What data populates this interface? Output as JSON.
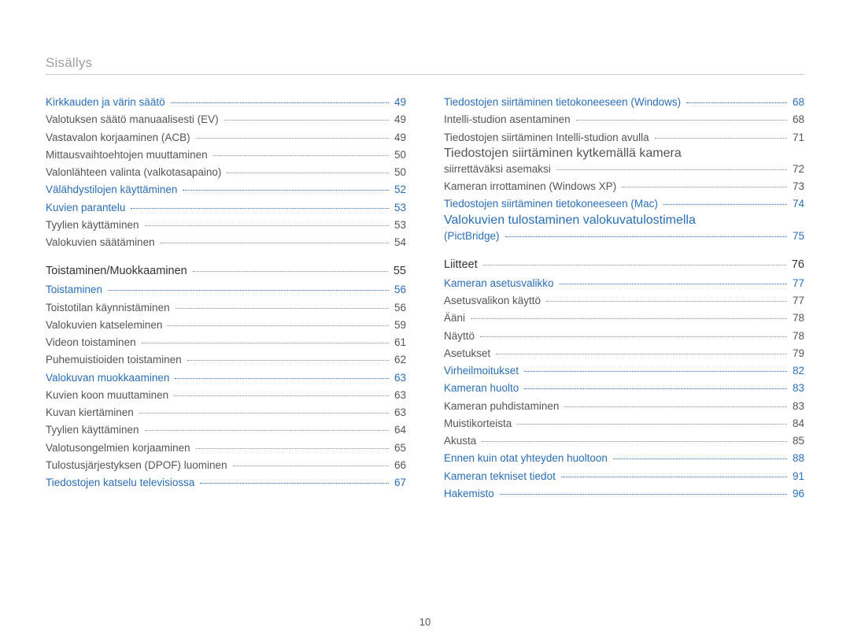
{
  "title": "Sisällys",
  "page_number": "10",
  "left": [
    {
      "label": "Kirkkauden ja värin säätö",
      "page": "49",
      "style": "blue"
    },
    {
      "label": "Valotuksen säätö manuaalisesti (EV)",
      "page": "49",
      "style": ""
    },
    {
      "label": "Vastavalon korjaaminen (ACB)",
      "page": "49",
      "style": ""
    },
    {
      "label": "Mittausvaihtoehtojen muuttaminen",
      "page": "50",
      "style": ""
    },
    {
      "label": "Valonlähteen valinta (valkotasapaino)",
      "page": "50",
      "style": ""
    },
    {
      "label": "Välähdystilojen käyttäminen",
      "page": "52",
      "style": "blue"
    },
    {
      "label": "Kuvien parantelu",
      "page": "53",
      "style": "blue"
    },
    {
      "label": "Tyylien käyttäminen",
      "page": "53",
      "style": ""
    },
    {
      "label": "Valokuvien säätäminen",
      "page": "54",
      "style": ""
    },
    {
      "label": "Toistaminen/Muokkaaminen",
      "page": "55",
      "style": "section-head dark"
    },
    {
      "label": "Toistaminen",
      "page": "56",
      "style": "blue"
    },
    {
      "label": "Toistotilan käynnistäminen",
      "page": "56",
      "style": ""
    },
    {
      "label": "Valokuvien katseleminen",
      "page": "59",
      "style": ""
    },
    {
      "label": "Videon toistaminen",
      "page": "61",
      "style": ""
    },
    {
      "label": "Puhemuistioiden toistaminen",
      "page": "62",
      "style": ""
    },
    {
      "label": "Valokuvan muokkaaminen",
      "page": "63",
      "style": "blue"
    },
    {
      "label": "Kuvien koon muuttaminen",
      "page": "63",
      "style": ""
    },
    {
      "label": "Kuvan kiertäminen",
      "page": "63",
      "style": ""
    },
    {
      "label": "Tyylien käyttäminen",
      "page": "64",
      "style": ""
    },
    {
      "label": "Valotusongelmien korjaaminen",
      "page": "65",
      "style": ""
    },
    {
      "label": "Tulostusjärjestyksen (DPOF) luominen",
      "page": "66",
      "style": ""
    },
    {
      "label": "Tiedostojen katselu televisiossa",
      "page": "67",
      "style": "blue"
    }
  ],
  "right": [
    {
      "label": "Tiedostojen siirtäminen tietokoneeseen (Windows)",
      "page": "68",
      "style": "blue"
    },
    {
      "label": "Intelli-studion asentaminen",
      "page": "68",
      "style": ""
    },
    {
      "label": "Tiedostojen siirtäminen Intelli-studion avulla",
      "page": "71",
      "style": ""
    },
    {
      "label_line1": "Tiedostojen siirtäminen kytkemällä kamera",
      "label": "siirrettäväksi asemaksi",
      "page": "72",
      "style": ""
    },
    {
      "label": "Kameran irrottaminen (Windows XP)",
      "page": "73",
      "style": ""
    },
    {
      "label": "Tiedostojen siirtäminen tietokoneeseen (Mac)",
      "page": "74",
      "style": "blue"
    },
    {
      "label_line1": "Valokuvien tulostaminen valokuvatulostimella",
      "label": "(PictBridge)",
      "page": "75",
      "style": "blue"
    },
    {
      "label": "Liitteet",
      "page": "76",
      "style": "section-head dark"
    },
    {
      "label": "Kameran asetusvalikko",
      "page": "77",
      "style": "blue"
    },
    {
      "label": "Asetusvalikon käyttö",
      "page": "77",
      "style": ""
    },
    {
      "label": "Ääni",
      "page": "78",
      "style": ""
    },
    {
      "label": "Näyttö",
      "page": "78",
      "style": ""
    },
    {
      "label": "Asetukset",
      "page": "79",
      "style": ""
    },
    {
      "label": "Virheilmoitukset",
      "page": "82",
      "style": "blue"
    },
    {
      "label": "Kameran huolto",
      "page": "83",
      "style": "blue"
    },
    {
      "label": "Kameran puhdistaminen",
      "page": "83",
      "style": ""
    },
    {
      "label": "Muistikorteista",
      "page": "84",
      "style": ""
    },
    {
      "label": "Akusta",
      "page": "85",
      "style": ""
    },
    {
      "label": "Ennen kuin otat yhteyden huoltoon",
      "page": "88",
      "style": "blue"
    },
    {
      "label": "Kameran tekniset tiedot",
      "page": "91",
      "style": "blue"
    },
    {
      "label": "Hakemisto",
      "page": "96",
      "style": "blue"
    }
  ]
}
